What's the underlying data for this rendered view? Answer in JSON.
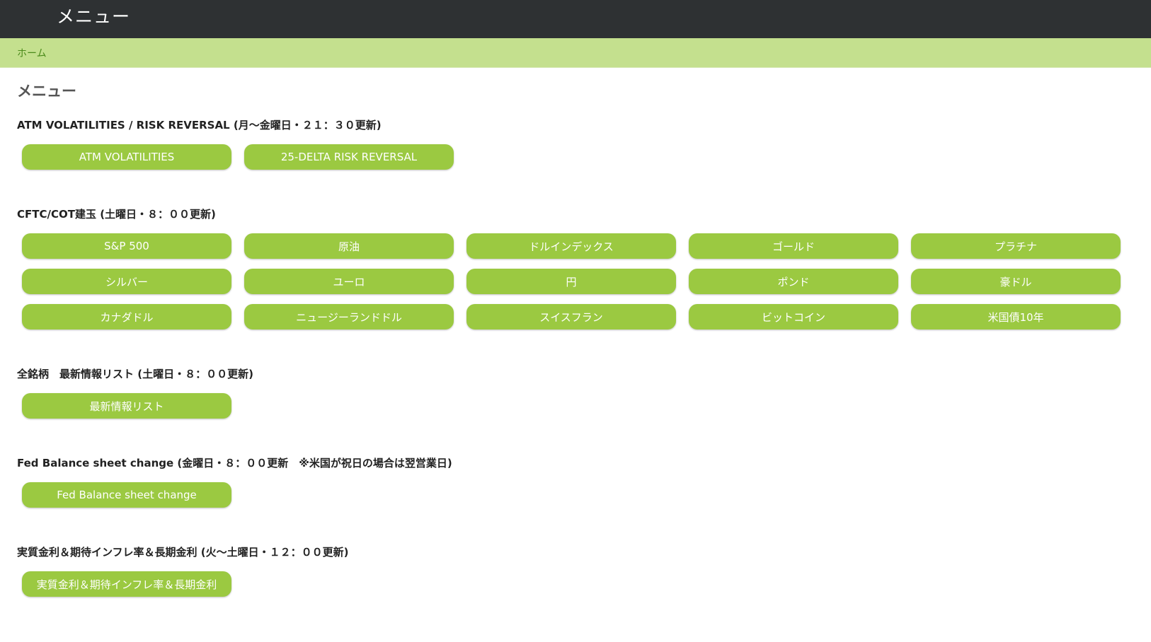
{
  "header": {
    "title": "メニュー"
  },
  "breadcrumb": {
    "home": "ホーム"
  },
  "page": {
    "title": "メニュー"
  },
  "sections": {
    "atm": {
      "heading": "ATM VOLATILITIES / RISK REVERSAL (月～金曜日・２１：３０更新)",
      "buttons": [
        "ATM VOLATILITIES",
        "25-DELTA RISK REVERSAL"
      ]
    },
    "cftc": {
      "heading": "CFTC/COT建玉 (土曜日・８：００更新)",
      "buttons": [
        "S&P 500",
        "原油",
        "ドルインデックス",
        "ゴールド",
        "プラチナ",
        "シルバー",
        "ユーロ",
        "円",
        "ポンド",
        "豪ドル",
        "カナダドル",
        "ニュージーランドドル",
        "スイスフラン",
        "ビットコイン",
        "米国債10年"
      ]
    },
    "all": {
      "heading": "全銘柄　最新情報リスト (土曜日・８：００更新)",
      "buttons": [
        "最新情報リスト"
      ]
    },
    "fed": {
      "heading": "Fed Balance sheet change (金曜日・８：００更新　※米国が祝日の場合は翌営業日)",
      "buttons": [
        "Fed Balance sheet change"
      ]
    },
    "real": {
      "heading": "実質金利＆期待インフレ率＆長期金利 (火～土曜日・１２：００更新)",
      "buttons": [
        "実質金利＆期待インフレ率＆長期金利"
      ]
    }
  },
  "colors": {
    "topbar": "#2e3133",
    "breadcrumb_bg": "#c4e08e",
    "button": "#9bc941"
  }
}
